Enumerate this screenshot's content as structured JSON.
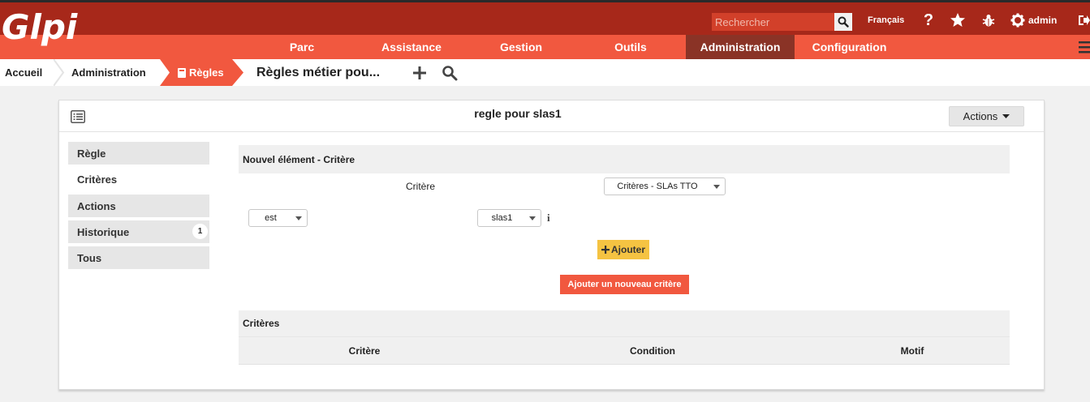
{
  "header": {
    "logo_text": "Glpi",
    "search_placeholder": "Rechercher",
    "language": "Français",
    "user": "admin"
  },
  "menu": {
    "items": [
      {
        "label": "Parc"
      },
      {
        "label": "Assistance"
      },
      {
        "label": "Gestion"
      },
      {
        "label": "Outils"
      },
      {
        "label": "Administration"
      },
      {
        "label": "Configuration"
      }
    ],
    "active": "Administration"
  },
  "breadcrumb": {
    "items": [
      "Accueil",
      "Administration",
      "Règles"
    ],
    "page_title": "Règles métier pou..."
  },
  "panel": {
    "title": "regle pour slas1",
    "actions_label": "Actions"
  },
  "tabs": [
    {
      "label": "Règle"
    },
    {
      "label": "Critères"
    },
    {
      "label": "Actions"
    },
    {
      "label": "Historique",
      "badge": "1"
    },
    {
      "label": "Tous"
    }
  ],
  "active_tab": "Critères",
  "form": {
    "heading": "Nouvel élément - Critère",
    "critere_label": "Critère",
    "critere_value": "Critères - SLAs TTO",
    "condition_value": "est",
    "pattern_value": "slas1",
    "add_label": "Ajouter",
    "add_new_label": "Ajouter un nouveau critère"
  },
  "criteria_table": {
    "title": "Critères",
    "columns": [
      "Critère",
      "Condition",
      "Motif"
    ]
  },
  "colors": {
    "topbar": "#a7281a",
    "menubar": "#f1583f",
    "menu_active": "#8a3326",
    "add_button": "#f5c342"
  }
}
